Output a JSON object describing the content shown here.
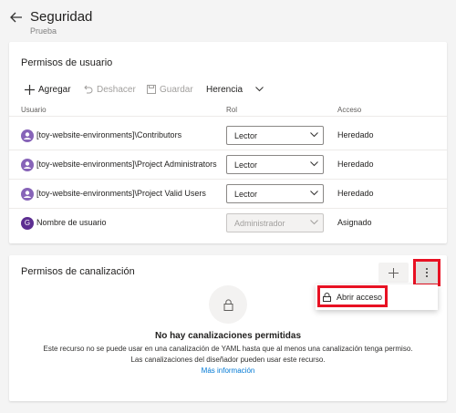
{
  "header": {
    "title": "Seguridad",
    "subtitle": "Prueba"
  },
  "user_permissions": {
    "title": "Permisos de usuario",
    "toolbar": {
      "add": "Agregar",
      "undo": "Deshacer",
      "save": "Guardar",
      "inherit": "Herencia"
    },
    "columns": {
      "user": "Usuario",
      "role": "Rol",
      "access": "Acceso"
    },
    "rows": [
      {
        "user": "[toy-website-environments]\\Contributors",
        "role": "Lector",
        "access": "Heredado",
        "avatar_color": "#8764b8"
      },
      {
        "user": "[toy-website-environments]\\Project Administrators",
        "role": "Lector",
        "access": "Heredado",
        "avatar_color": "#8764b8"
      },
      {
        "user": "[toy-website-environments]\\Project Valid Users",
        "role": "Lector",
        "access": "Heredado",
        "avatar_color": "#8764b8"
      },
      {
        "user": "Nombre de usuario",
        "role": "Administrador",
        "access": "Asignado",
        "avatar_color": "#5c2e91",
        "avatar_letter": "G",
        "disabled": true
      }
    ]
  },
  "pipeline_permissions": {
    "title": "Permisos de canalización",
    "menu": {
      "open_access": "Abrir acceso"
    },
    "empty": {
      "title": "No hay canalizaciones permitidas",
      "desc1": "Este recurso no se puede usar en una canalización de YAML hasta que al menos una canalización tenga permiso.",
      "desc2": "Las canalizaciones del diseñador pueden usar este recurso.",
      "link": "Más información"
    }
  },
  "colors": {
    "accent": "#0078d4",
    "highlight": "#e81123"
  }
}
